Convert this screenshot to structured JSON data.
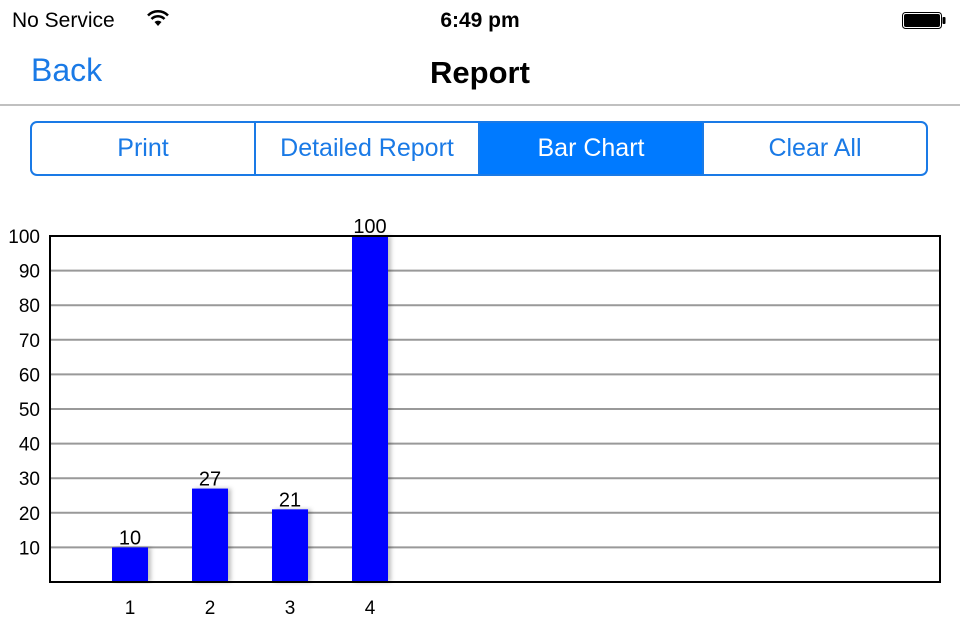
{
  "status_bar": {
    "carrier": "No Service",
    "time": "6:49 pm",
    "wifi_icon": "wifi-icon",
    "battery_icon": "battery-icon"
  },
  "nav": {
    "back_label": "Back",
    "title": "Report"
  },
  "segments": [
    {
      "label": "Print",
      "active": false
    },
    {
      "label": "Detailed Report",
      "active": false
    },
    {
      "label": "Bar Chart",
      "active": true
    },
    {
      "label": "Clear All",
      "active": false
    }
  ],
  "colors": {
    "accent": "#007aff",
    "bar": "#0000ff",
    "grid": "#999999"
  },
  "chart_data": {
    "type": "bar",
    "categories": [
      "1",
      "2",
      "3",
      "4"
    ],
    "values": [
      10,
      27,
      21,
      100
    ],
    "data_labels": [
      "10",
      "27",
      "21",
      "100"
    ],
    "yticks": [
      "10",
      "20",
      "30",
      "40",
      "50",
      "60",
      "70",
      "80",
      "90",
      "100"
    ],
    "ylim": [
      0,
      100
    ],
    "grid": true
  }
}
